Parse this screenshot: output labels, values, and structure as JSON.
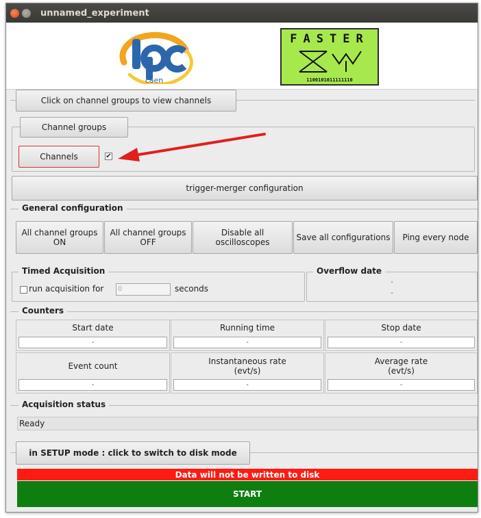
{
  "window": {
    "title": "unnamed_experiment"
  },
  "logos": {
    "lpc_text": "caen",
    "faster_text": "FASTER",
    "faster_bits": "1100101011111110"
  },
  "header": {
    "channel_groups_hint": "Click on channel groups to view channels"
  },
  "view": {
    "channel_groups_button": "Channel groups",
    "channels_button": "Channels",
    "channels_checked": true,
    "channels_check_glyph": "✔"
  },
  "trigger_merger_button": "trigger-merger configuration",
  "general": {
    "label": "General configuration",
    "buttons": [
      "All channel groups ON",
      "All channel groups OFF",
      "Disable all oscilloscopes",
      "Save all configurations",
      "Ping every node"
    ]
  },
  "timed": {
    "label": "Timed Acquisition",
    "checkbox_label": "run acquisition for",
    "value": "0",
    "unit": "seconds"
  },
  "overflow": {
    "label": "Overflow date",
    "line1": "-",
    "line2": "-"
  },
  "counters": {
    "label": "Counters",
    "start_date": {
      "label": "Start date",
      "value": "-"
    },
    "running_time": {
      "label": "Running time",
      "value": "-"
    },
    "stop_date": {
      "label": "Stop date",
      "value": "-"
    },
    "event_count": {
      "label": "Event count",
      "value": "-"
    },
    "instant_rate": {
      "label": "Instantaneous rate\n(evt/s)",
      "value": "-"
    },
    "average_rate": {
      "label": "Average rate\n(evt/s)",
      "value": "-"
    }
  },
  "acquisition": {
    "label": "Acquisition status",
    "status": "Ready"
  },
  "mode_button": "in SETUP mode : click to switch to disk mode",
  "warning": "Data will not be written to disk",
  "start_button": "START",
  "colors": {
    "warning_red": "#ff1a12",
    "start_green": "#0e7e10",
    "annotation_red": "#e0201c",
    "faster_green": "#a7e84d"
  }
}
